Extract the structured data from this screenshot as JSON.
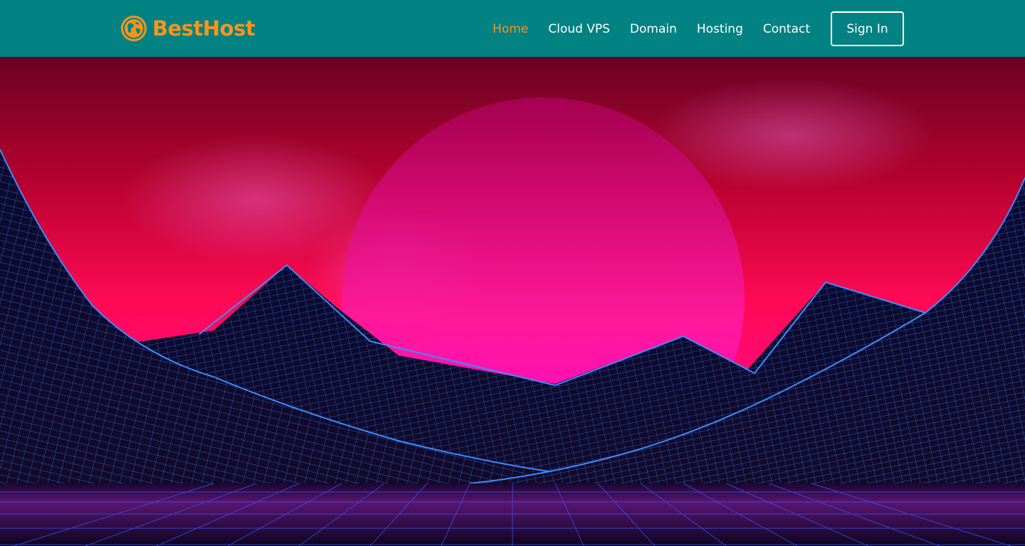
{
  "brand": {
    "name": "BestHost",
    "logo_icon": "globe-icon",
    "color": "#f7941d"
  },
  "nav": {
    "items": [
      {
        "label": "Home",
        "active": true
      },
      {
        "label": "Cloud VPS",
        "active": false
      },
      {
        "label": "Domain",
        "active": false
      },
      {
        "label": "Hosting",
        "active": false
      },
      {
        "label": "Contact",
        "active": false
      }
    ],
    "signin_label": "Sign In"
  },
  "colors": {
    "navbar_bg": "#028283",
    "accent": "#f7941d",
    "text": "#ffffff",
    "sky_top": "#6a0225",
    "sky_mid": "#ff0a5a",
    "sun_bottom": "#ff00cc",
    "wireframe": "#1f6bff"
  }
}
